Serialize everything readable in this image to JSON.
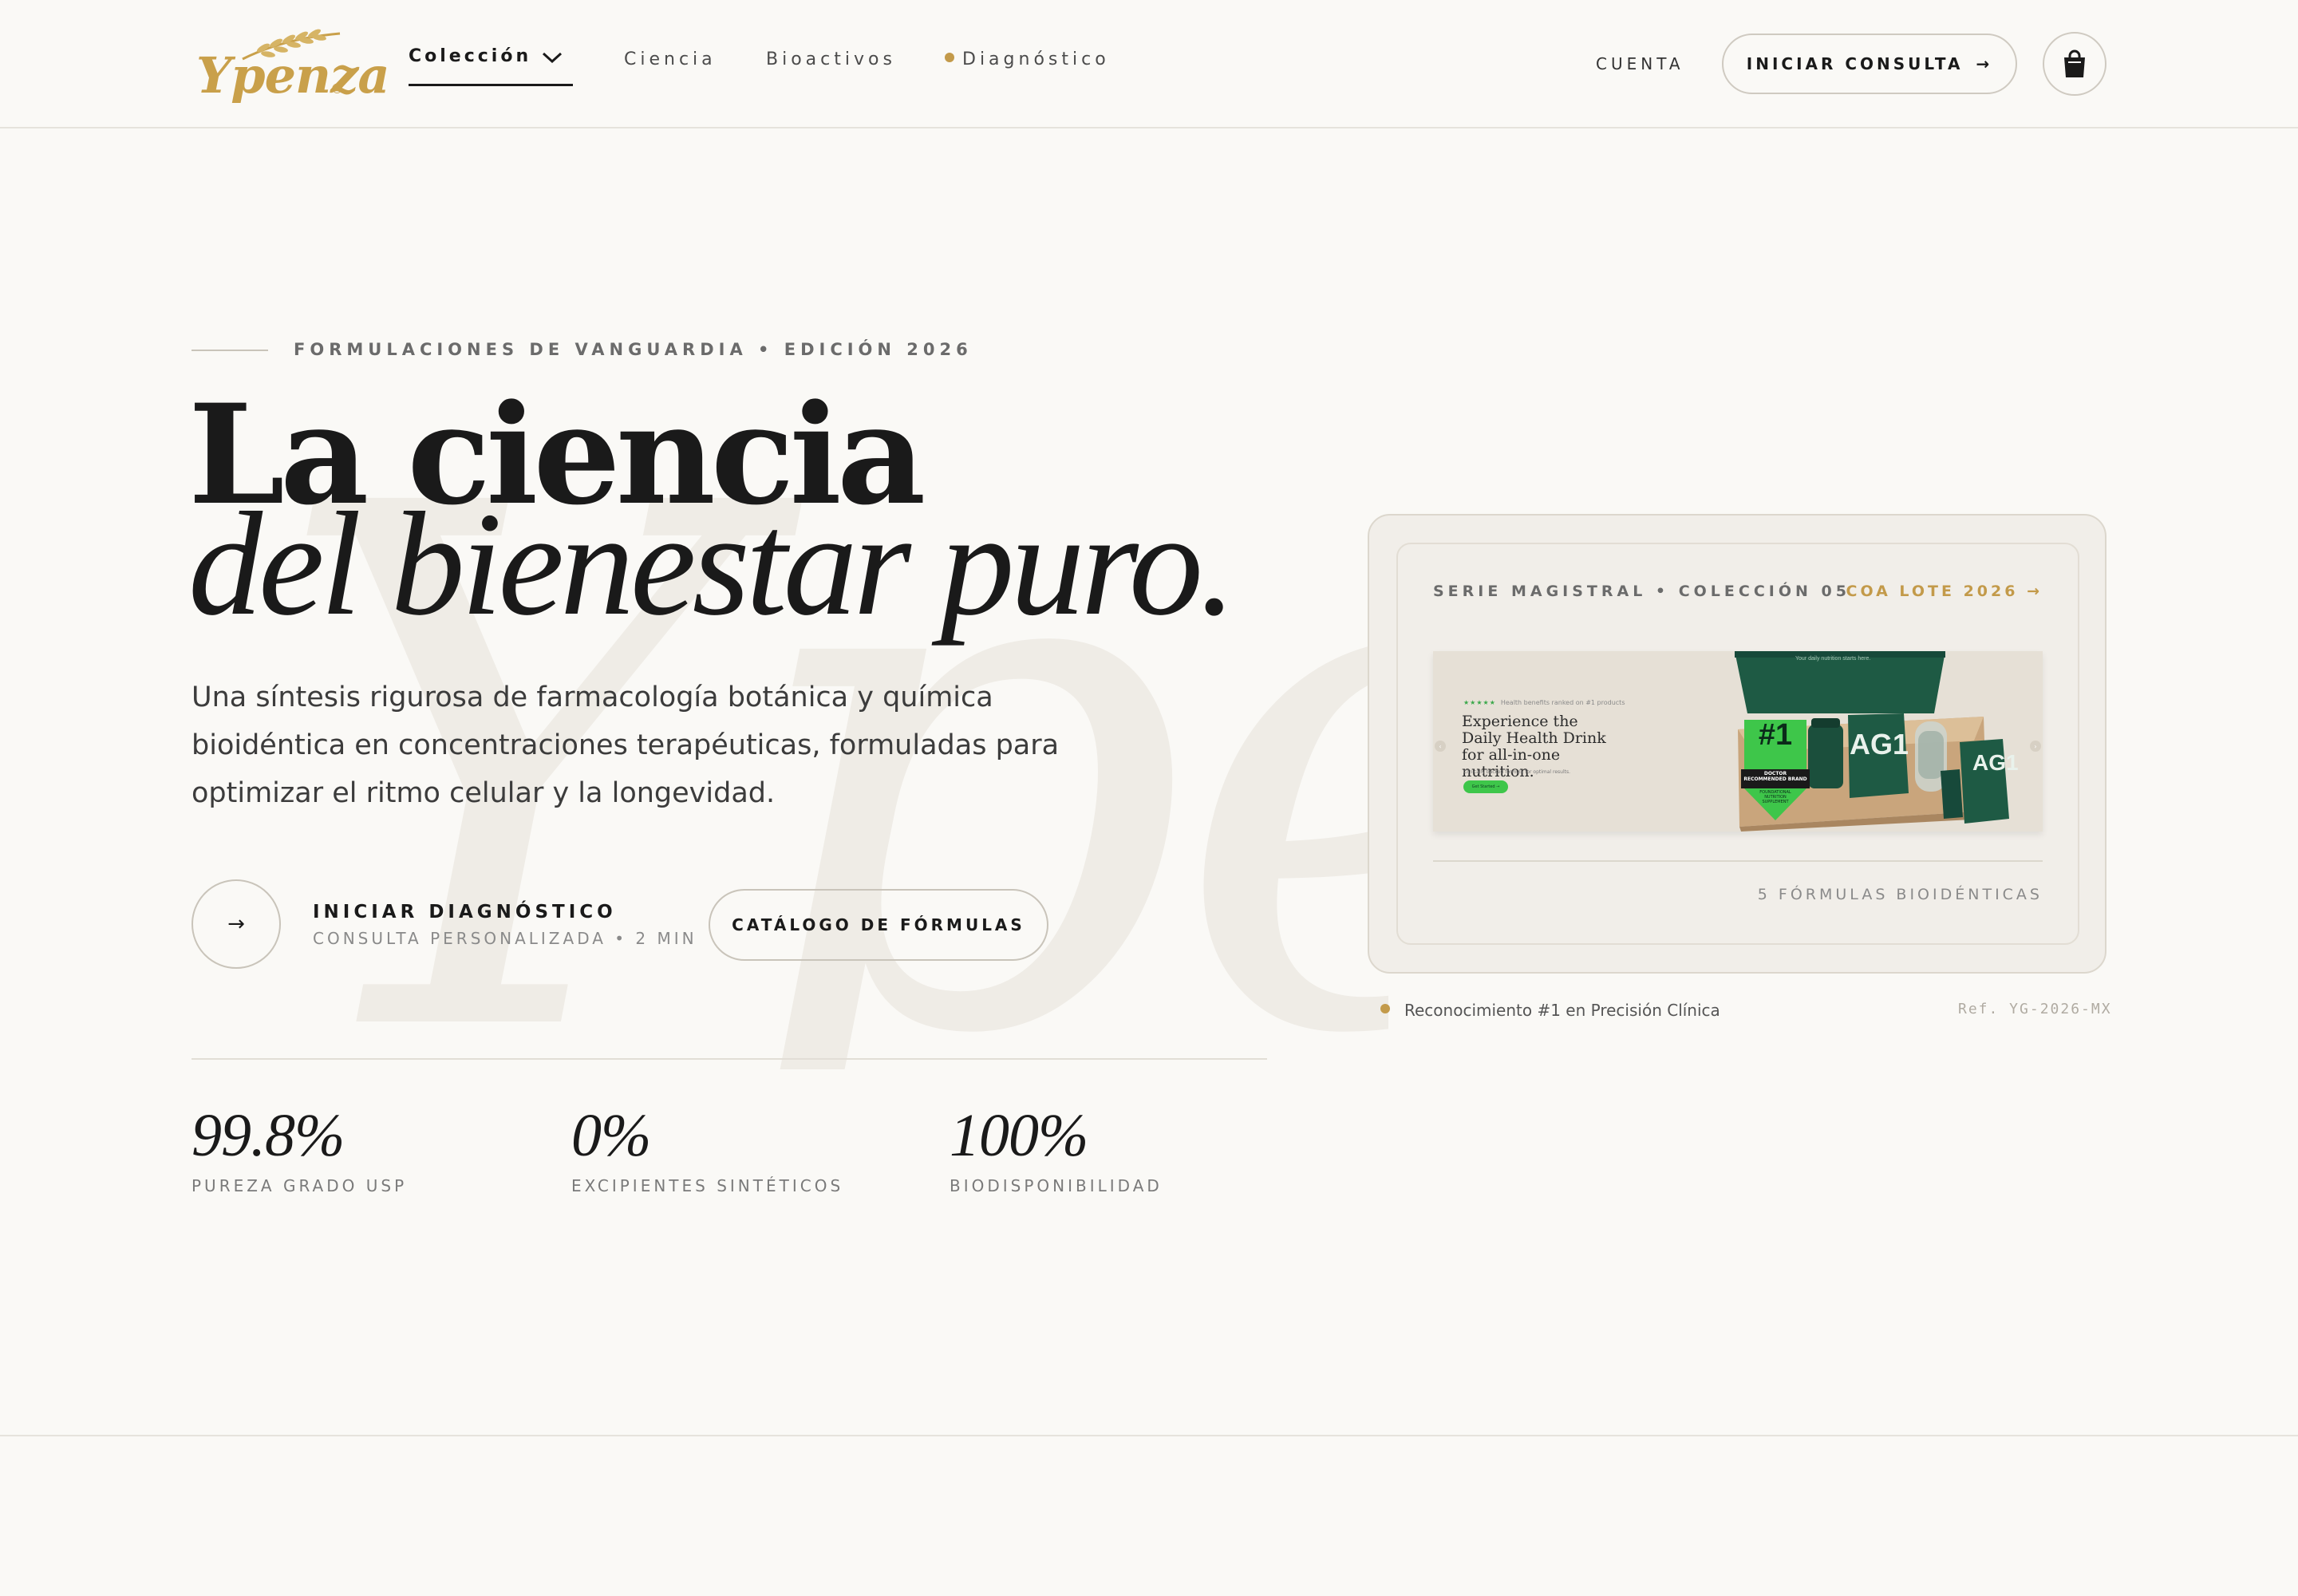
{
  "brand": {
    "name": "Ypenza",
    "reg": "®",
    "color": "#c9a04a"
  },
  "nav": {
    "active": "Colección",
    "items": [
      "Ciencia",
      "Bioactivos",
      "Diagnóstico"
    ],
    "diag_dot_color": "#c39a4a"
  },
  "header": {
    "account": "CUENTA",
    "consult_label": "INICIAR CONSULTA",
    "consult_arrow": "→",
    "cart_icon": "shopping-bag-icon"
  },
  "hero": {
    "watermark": "Ypenza",
    "eyebrow": "FORMULACIONES DE VANGUARDIA • EDICIÓN 2026",
    "title_line1": "La ciencia",
    "title_line2": "del bienestar puro.",
    "lead": "Una síntesis rigurosa de farmacología botánica y química bioidéntica en concentraciones terapéuticas, formuladas para optimizar el ritmo celular y la longevidad.",
    "primary_arrow": "→",
    "primary_title": "INICIAR DIAGNÓSTICO",
    "primary_sub": "CONSULTA PERSONALIZADA • 2 MIN",
    "secondary_label": "CATÁLOGO DE FÓRMULAS"
  },
  "stats": [
    {
      "value": "99.8%",
      "label": "PUREZA GRADO USP"
    },
    {
      "value": "0%",
      "label": "EXCIPIENTES SINTÉTICOS"
    },
    {
      "value": "100%",
      "label": "BIODISPONIBILIDAD"
    }
  ],
  "card": {
    "series": "SERIE MAGISTRAL • COLECCIÓN 05",
    "coa": "COA LOTE 2026 →",
    "count": "5 FÓRMULAS BIOIDÉNTICAS",
    "image": {
      "stars": "★★★★★",
      "stars_note": "Health benefits ranked on #1 products",
      "headline": "Experience the Daily Health Drink for all-in-one nutrition.",
      "sub": "Clinically backed formula for optimal results.",
      "cta": "Get Started →",
      "badge_num": "#1",
      "badge_text": "DOCTOR RECOMMENDED BRAND",
      "badge_text2": "FOUNDATIONAL NUTRITION SUPPLEMENT",
      "product": "AG1",
      "box_text": "Your daily nutrition starts here.",
      "accent_green": "#3ec64a",
      "box_green": "#1e5a44"
    },
    "recognition": "Reconocimiento #1 en Precisión Clínica",
    "ref": "Ref. YG-2026-MX"
  }
}
